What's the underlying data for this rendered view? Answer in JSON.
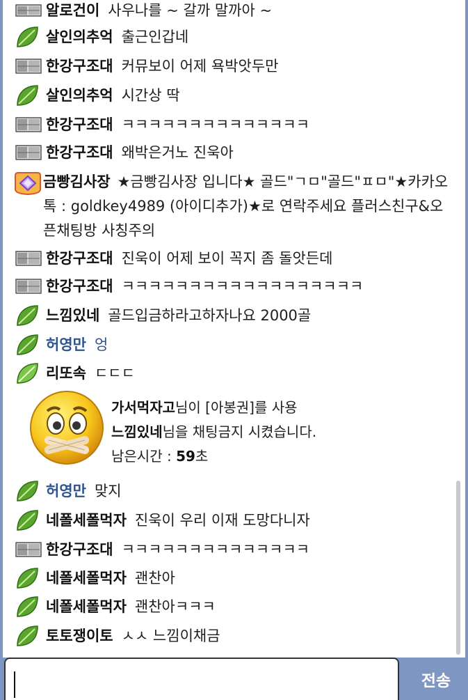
{
  "messages": [
    {
      "badge": "metal-icon",
      "nick": "알로건이",
      "text": "사우나를 ~ 갈까 말까아 ~"
    },
    {
      "badge": "leaf-icon",
      "nick": "살인의추억",
      "text": "출근인갑네"
    },
    {
      "badge": "metal-icon",
      "nick": "한강구조대",
      "text": "커뮤보이 어제 욕박앗두만"
    },
    {
      "badge": "leaf-icon",
      "nick": "살인의추억",
      "text": "시간상 딱"
    },
    {
      "badge": "metal-icon",
      "nick": "한강구조대",
      "text": "ㅋㅋㅋㅋㅋㅋㅋㅋㅋㅋㅋㅋㅋㅋ"
    },
    {
      "badge": "metal-icon",
      "nick": "한강구조대",
      "text": "왜박은거노 진욱아"
    },
    {
      "badge": "diamond-badge-icon",
      "nick": "금빵김사장",
      "text": "★금빵김사장 입니다★ 골드\"ㄱㅁ\"골드\"ㅍㅁ\"★카카오톡 : goldkey4989 (아이디추가)★로 연락주세요 플러스친구&오픈채팅방 사칭주의"
    },
    {
      "badge": "metal-icon",
      "nick": "한강구조대",
      "text": "진욱이 어제 보이 꼭지 좀 돌앗든데"
    },
    {
      "badge": "metal-icon",
      "nick": "한강구조대",
      "text": "ㅋㅋㅋㅋㅋㅋㅋㅋㅋㅋㅋㅋㅋㅋㅋㅋㅋㅋ"
    },
    {
      "badge": "leaf-icon",
      "nick": "느낌있네",
      "text": "골드입금하라고하자나요 2000골"
    },
    {
      "badge": "leaf-icon",
      "nick": "허영만",
      "text": "엉"
    },
    {
      "badge": "leaf-icon",
      "nick": "리또속",
      "text": "ㄷㄷㄷ"
    },
    {
      "badge": "leaf-icon",
      "nick": "허영만",
      "text": "맞지"
    },
    {
      "badge": "leaf-icon",
      "nick": "네폴세폴먹자",
      "text": "진욱이 우리 이재 도망다니자"
    },
    {
      "badge": "metal-icon",
      "nick": "한강구조대",
      "text": "ㅋㅋㅋㅋㅋㅋㅋㅋㅋㅋㅋㅋㅋㅋ"
    },
    {
      "badge": "leaf-icon",
      "nick": "네폴세폴먹자",
      "text": "괜찬아"
    },
    {
      "badge": "leaf-icon",
      "nick": "네폴세폴먹자",
      "text": "괜찬아ㅋㅋㅋ"
    },
    {
      "badge": "leaf-icon",
      "nick": "토토쟁이토",
      "text": "ㅅㅅ 느낌이채금"
    }
  ],
  "system_notice": {
    "emoji": "muted-face-icon",
    "actor": "가서먹자고",
    "line1_rest": "님이 [아봉권]를 사용",
    "target": "느낌있네",
    "line2_rest": "님을 채팅금지 시켰습니다.",
    "remaining_label": "남은시간 : ",
    "remaining_value": "59",
    "remaining_unit": "초"
  },
  "input": {
    "value": ""
  },
  "send_button": {
    "label": "전송"
  },
  "colors": {
    "frame": "#7d97c2",
    "nick_blue": "#2d5491",
    "leaf": "#5aa52e"
  }
}
